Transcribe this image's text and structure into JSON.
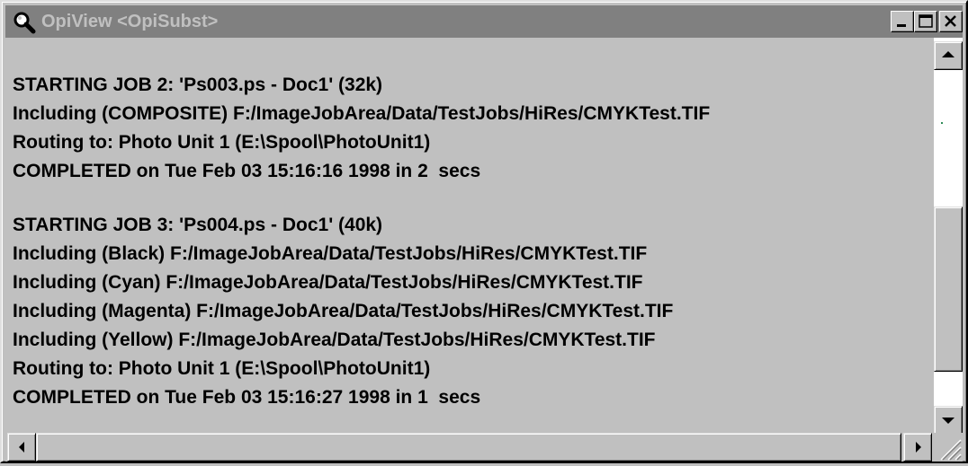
{
  "window": {
    "title": "OpiView <OpiSubst>",
    "app_icon": "magnifier-icon",
    "controls": {
      "minimize": "minimize-icon",
      "maximize": "maximize-icon",
      "close": "close-icon"
    }
  },
  "log": {
    "job2": {
      "lines": [
        "STARTING JOB 2: 'Ps003.ps - Doc1' (32k)",
        "Including (COMPOSITE) F:/ImageJobArea/Data/TestJobs/HiRes/CMYKTest.TIF",
        "Routing to: Photo Unit 1 (E:\\Spool\\PhotoUnit1)",
        "COMPLETED on Tue Feb 03 15:16:16 1998 in 2  secs"
      ]
    },
    "job3": {
      "lines": [
        "STARTING JOB 3: 'Ps004.ps - Doc1' (40k)",
        "Including (Black) F:/ImageJobArea/Data/TestJobs/HiRes/CMYKTest.TIF",
        "Including (Cyan) F:/ImageJobArea/Data/TestJobs/HiRes/CMYKTest.TIF",
        "Including (Magenta) F:/ImageJobArea/Data/TestJobs/HiRes/CMYKTest.TIF",
        "Including (Yellow) F:/ImageJobArea/Data/TestJobs/HiRes/CMYKTest.TIF",
        "Routing to: Photo Unit 1 (E:\\Spool\\PhotoUnit1)",
        "COMPLETED on Tue Feb 03 15:16:27 1998 in 1  secs"
      ]
    }
  },
  "colors": {
    "titlebar_inactive": "#808080",
    "title_text": "#c0c0c0",
    "face": "#c0c0c0"
  },
  "scrollbars": {
    "vertical_icons": [
      "arrow-up-icon",
      "arrow-down-icon"
    ],
    "horizontal_icons": [
      "arrow-left-icon",
      "arrow-right-icon"
    ]
  }
}
